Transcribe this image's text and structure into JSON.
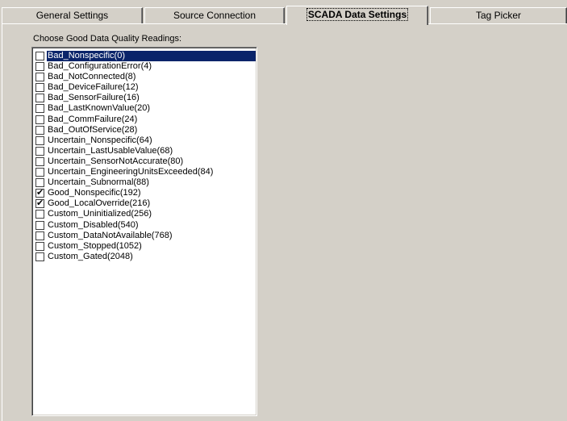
{
  "tabs": [
    {
      "label": "General Settings"
    },
    {
      "label": "Source Connection"
    },
    {
      "label": "SCADA Data Settings"
    },
    {
      "label": "Tag Picker"
    }
  ],
  "selected_tab": "SCADA Data Settings",
  "group_label": "Choose Good Data Quality Readings:",
  "selection_color": "#0a246a",
  "checkmark_glyph": "✔",
  "items": [
    {
      "label": "Bad_Nonspecific(0)",
      "checked": false,
      "selected": true
    },
    {
      "label": "Bad_ConfigurationError(4)",
      "checked": false,
      "selected": false
    },
    {
      "label": "Bad_NotConnected(8)",
      "checked": false,
      "selected": false
    },
    {
      "label": "Bad_DeviceFailure(12)",
      "checked": false,
      "selected": false
    },
    {
      "label": "Bad_SensorFailure(16)",
      "checked": false,
      "selected": false
    },
    {
      "label": "Bad_LastKnownValue(20)",
      "checked": false,
      "selected": false
    },
    {
      "label": "Bad_CommFailure(24)",
      "checked": false,
      "selected": false
    },
    {
      "label": "Bad_OutOfService(28)",
      "checked": false,
      "selected": false
    },
    {
      "label": "Uncertain_Nonspecific(64)",
      "checked": false,
      "selected": false
    },
    {
      "label": "Uncertain_LastUsableValue(68)",
      "checked": false,
      "selected": false
    },
    {
      "label": "Uncertain_SensorNotAccurate(80)",
      "checked": false,
      "selected": false
    },
    {
      "label": "Uncertain_EngineeringUnitsExceeded(84)",
      "checked": false,
      "selected": false
    },
    {
      "label": "Uncertain_Subnormal(88)",
      "checked": false,
      "selected": false
    },
    {
      "label": "Good_Nonspecific(192)",
      "checked": true,
      "selected": false
    },
    {
      "label": "Good_LocalOverride(216)",
      "checked": true,
      "selected": false
    },
    {
      "label": "Custom_Uninitialized(256)",
      "checked": false,
      "selected": false
    },
    {
      "label": "Custom_Disabled(540)",
      "checked": false,
      "selected": false
    },
    {
      "label": "Custom_DataNotAvailable(768)",
      "checked": false,
      "selected": false
    },
    {
      "label": "Custom_Stopped(1052)",
      "checked": false,
      "selected": false
    },
    {
      "label": "Custom_Gated(2048)",
      "checked": false,
      "selected": false
    }
  ]
}
